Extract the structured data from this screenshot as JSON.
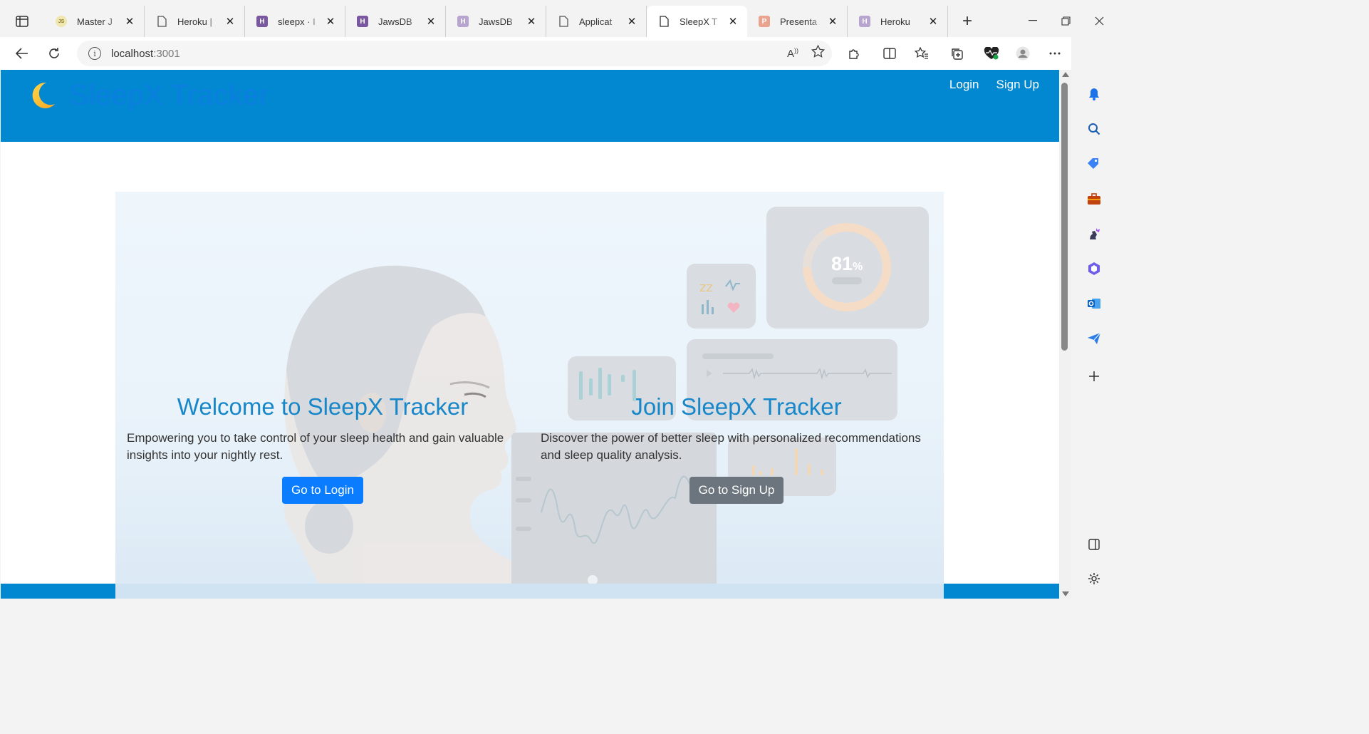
{
  "browser": {
    "tabs": [
      {
        "title": "Master J",
        "favicon": "js-icon",
        "color": "#e8c441",
        "active": false
      },
      {
        "title": "Heroku |",
        "favicon": "page-icon",
        "color": "#555555",
        "active": false
      },
      {
        "title": "sleepx · I",
        "favicon": "heroku-icon",
        "color": "#79589f",
        "active": false
      },
      {
        "title": "JawsDB",
        "favicon": "heroku-icon",
        "color": "#79589f",
        "active": false
      },
      {
        "title": "JawsDB",
        "favicon": "heroku-icon",
        "color": "#b7a5cf",
        "active": false
      },
      {
        "title": "Applicat",
        "favicon": "page-icon",
        "color": "#555555",
        "active": false
      },
      {
        "title": "SleepX T",
        "favicon": "page-icon",
        "color": "#555555",
        "active": true
      },
      {
        "title": "Presenta",
        "favicon": "powerpoint-icon",
        "color": "#d9603f",
        "active": false
      },
      {
        "title": "Heroku",
        "favicon": "heroku-icon",
        "color": "#b7a5cf",
        "active": false
      }
    ],
    "address": "localhost:3001",
    "address_host": "localhost",
    "address_port": ":3001"
  },
  "site": {
    "brand": "SleepX Tracker",
    "nav": {
      "login": "Login",
      "signup": "Sign Up"
    },
    "accent": "#0288d1"
  },
  "hero": {
    "left": {
      "heading": "Welcome to SleepX Tracker",
      "text": "Empowering you to take control of your sleep health and gain valuable insights into your nightly rest.",
      "button": "Go to Login"
    },
    "right": {
      "heading": "Join SleepX Tracker",
      "text": "Discover the power of better sleep with personalized recommendations and sleep quality analysis.",
      "button": "Go to Sign Up"
    },
    "ring_value": "81",
    "ring_unit": "%",
    "ring_fraction": 0.81
  }
}
